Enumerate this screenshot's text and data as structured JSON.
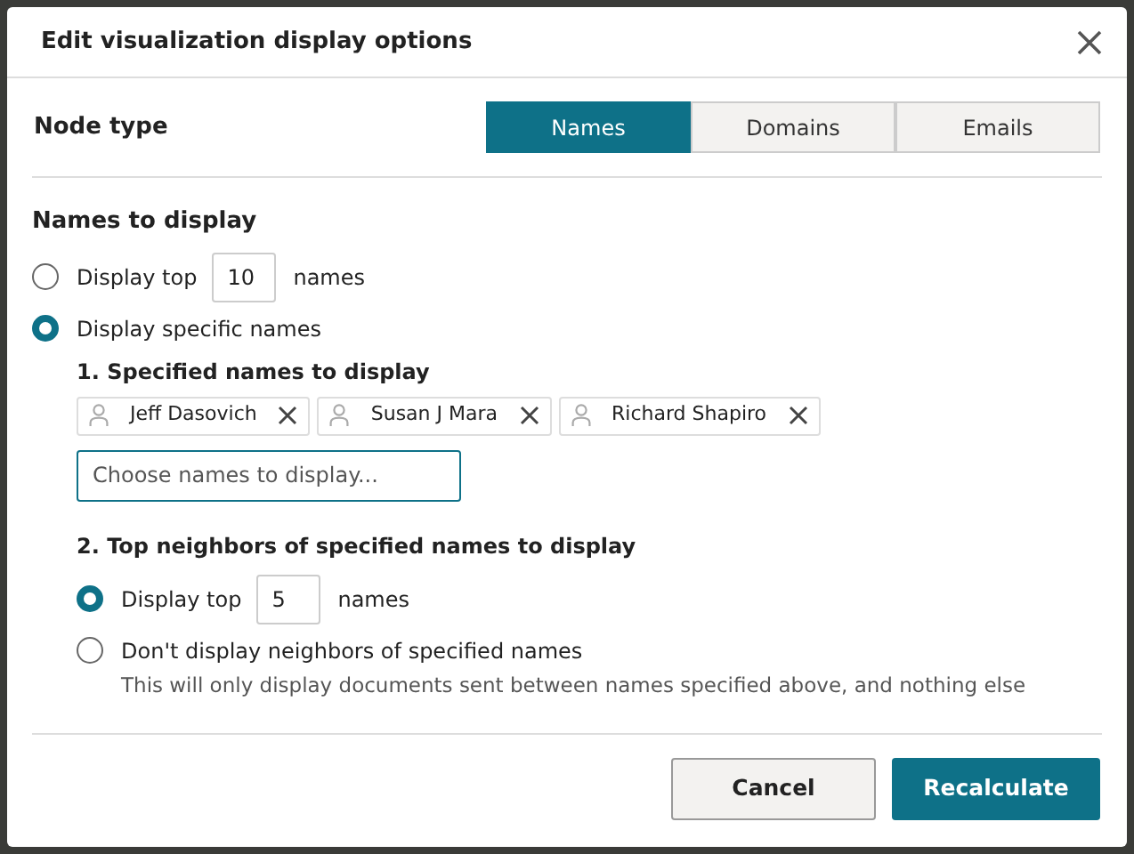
{
  "dialog": {
    "title": "Edit visualization display options"
  },
  "node_type": {
    "label": "Node type",
    "options": [
      {
        "label": "Names",
        "selected": true
      },
      {
        "label": "Domains",
        "selected": false
      },
      {
        "label": "Emails",
        "selected": false
      }
    ]
  },
  "names_section": {
    "heading": "Names to display",
    "options": [
      {
        "kind": "count",
        "prefix": "Display top",
        "value": "10",
        "suffix": "names",
        "selected": false
      },
      {
        "kind": "plain",
        "label": "Display specific names",
        "selected": true
      }
    ]
  },
  "specified": {
    "heading": "1. Specified names to display",
    "chips": [
      "Jeff Dasovich",
      "Susan J Mara",
      "Richard Shapiro"
    ],
    "placeholder": "Choose names to display..."
  },
  "neighbors": {
    "heading": "2. Top neighbors of specified names to display",
    "options": [
      {
        "kind": "count",
        "prefix": "Display top",
        "value": "5",
        "suffix": "names",
        "selected": true
      },
      {
        "kind": "plain",
        "label": "Don't display neighbors of specified names",
        "description": "This will only display documents sent between names specified above, and nothing else",
        "selected": false
      }
    ]
  },
  "buttons": [
    {
      "label": "Cancel",
      "kind": "secondary"
    },
    {
      "label": "Recalculate",
      "kind": "primary"
    }
  ]
}
